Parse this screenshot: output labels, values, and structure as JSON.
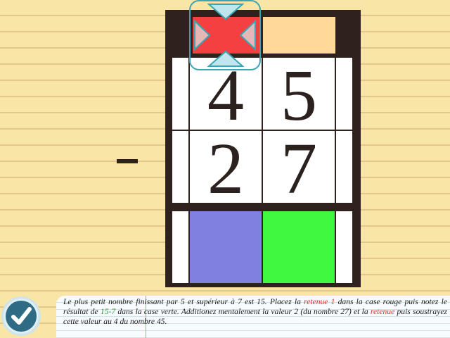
{
  "operation": {
    "symbol": "-"
  },
  "columns": {
    "tens": {
      "top_digit": "4",
      "bottom_digit": "2",
      "carry_slot_color": "#f44040",
      "result_slot_color": "#8080e0"
    },
    "units": {
      "top_digit": "5",
      "bottom_digit": "7",
      "carry_slot_color": "#ffd89a",
      "result_slot_color": "#40f840"
    }
  },
  "colors": {
    "board": "#2f211e",
    "paper": "#f9e6a7",
    "selector": "#3aa6b3",
    "check_button": "#2f6b84"
  },
  "validate_button": {
    "icon": "check-icon"
  },
  "selector": {
    "arrows": [
      "up-arrow-icon",
      "down-arrow-icon",
      "left-arrow-icon",
      "right-arrow-icon"
    ]
  },
  "instruction": {
    "part1": "Le plus petit nombre finissant par 5 et supérieur à 7 est 15. Placez la ",
    "retenue1": "retenue 1",
    "part2": " dans la case rouge puis notez le résultat de ",
    "calc": "15-7",
    "part3": " dans la case verte. Additionez mentalement la valeur 2 (du nombre 27) et la ",
    "retenue2": "retenue",
    "part4": " puis soustrayez cette valeur au 4 du nombre 45."
  }
}
